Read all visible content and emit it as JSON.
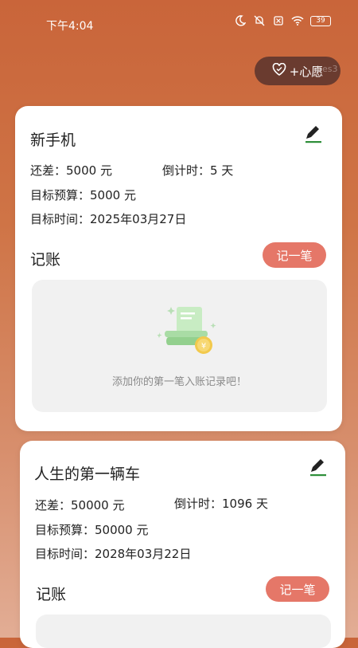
{
  "status_bar": {
    "time": "下午4:04",
    "battery": "39",
    "icons": [
      "moon-icon",
      "mute-icon",
      "sim-icon",
      "wifi-icon",
      "battery-icon"
    ]
  },
  "header": {
    "wish_button_label": "+心愿",
    "wish_ghost_text": "bes3"
  },
  "colors": {
    "accent": "#e57768",
    "wish_button_bg": "#6a3b2f",
    "background_top": "#c9653a",
    "background_bottom": "#e2ad95"
  },
  "wishes": [
    {
      "title": "新手机",
      "remaining": "还差：5000 元",
      "countdown": "倒计时：5 天",
      "budget": "目标预算：5000 元",
      "target_date": "目标时间：2025年03月27日",
      "section_title": "记账",
      "record_button": "记一笔",
      "empty_text": "添加你的第一笔入账记录吧！"
    },
    {
      "title": "人生的第一辆车",
      "remaining": "还差：50000 元",
      "countdown": "倒计时：1096 天",
      "budget": "目标预算：50000 元",
      "target_date": "目标时间：2028年03月22日",
      "section_title": "记账",
      "record_button": "记一笔"
    }
  ]
}
